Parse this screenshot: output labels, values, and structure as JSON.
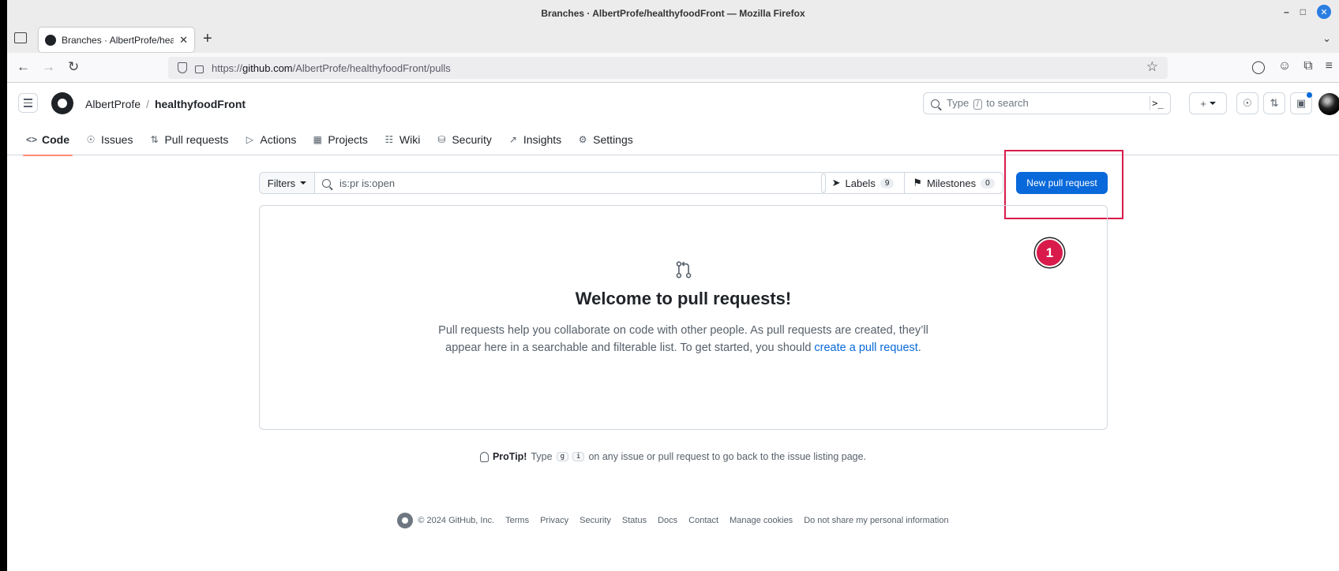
{
  "browser": {
    "window_title": "Branches · AlbertProfe/healthyfoodFront — Mozilla Firefox",
    "tab_title": "Branches · AlbertProfe/heal",
    "url_prefix": "https://",
    "url_host": "github.com",
    "url_path": "/AlbertProfe/healthyfoodFront/pulls"
  },
  "header": {
    "owner": "AlbertProfe",
    "separator": "/",
    "repo": "healthyfoodFront",
    "search_prefix": "Type",
    "search_key": "/",
    "search_suffix": "to search",
    "cmd_glyph": ">_"
  },
  "repo_nav": [
    {
      "label": "Code",
      "icon": "code-icon"
    },
    {
      "label": "Issues",
      "icon": "issue-icon"
    },
    {
      "label": "Pull requests",
      "icon": "pull-request-icon"
    },
    {
      "label": "Actions",
      "icon": "play-icon"
    },
    {
      "label": "Projects",
      "icon": "table-icon"
    },
    {
      "label": "Wiki",
      "icon": "book-icon"
    },
    {
      "label": "Security",
      "icon": "shield-icon"
    },
    {
      "label": "Insights",
      "icon": "graph-icon"
    },
    {
      "label": "Settings",
      "icon": "gear-icon"
    }
  ],
  "toolbar": {
    "filters_label": "Filters",
    "filter_value": "is:pr is:open",
    "labels_label": "Labels",
    "labels_count": "9",
    "milestones_label": "Milestones",
    "milestones_count": "0",
    "new_pr_label": "New pull request"
  },
  "annotation": {
    "step_number": "1",
    "color": "#d81b4b"
  },
  "blankslate": {
    "title": "Welcome to pull requests!",
    "text_1": "Pull requests help you collaborate on code with other people. As pull requests are created, they’ll appear here in a searchable and filterable list. To get started, you should ",
    "link": "create a pull request",
    "text_2": "."
  },
  "protip": {
    "label": "ProTip!",
    "text_1": "Type",
    "key_1": "g",
    "key_2": "i",
    "text_2": "on any issue or pull request to go back to the issue listing page."
  },
  "footer": {
    "copyright": "© 2024 GitHub, Inc.",
    "links": [
      "Terms",
      "Privacy",
      "Security",
      "Status",
      "Docs",
      "Contact",
      "Manage cookies",
      "Do not share my personal information"
    ]
  },
  "colors": {
    "accent": "#0969da",
    "nav_underline": "#fd8c73"
  }
}
